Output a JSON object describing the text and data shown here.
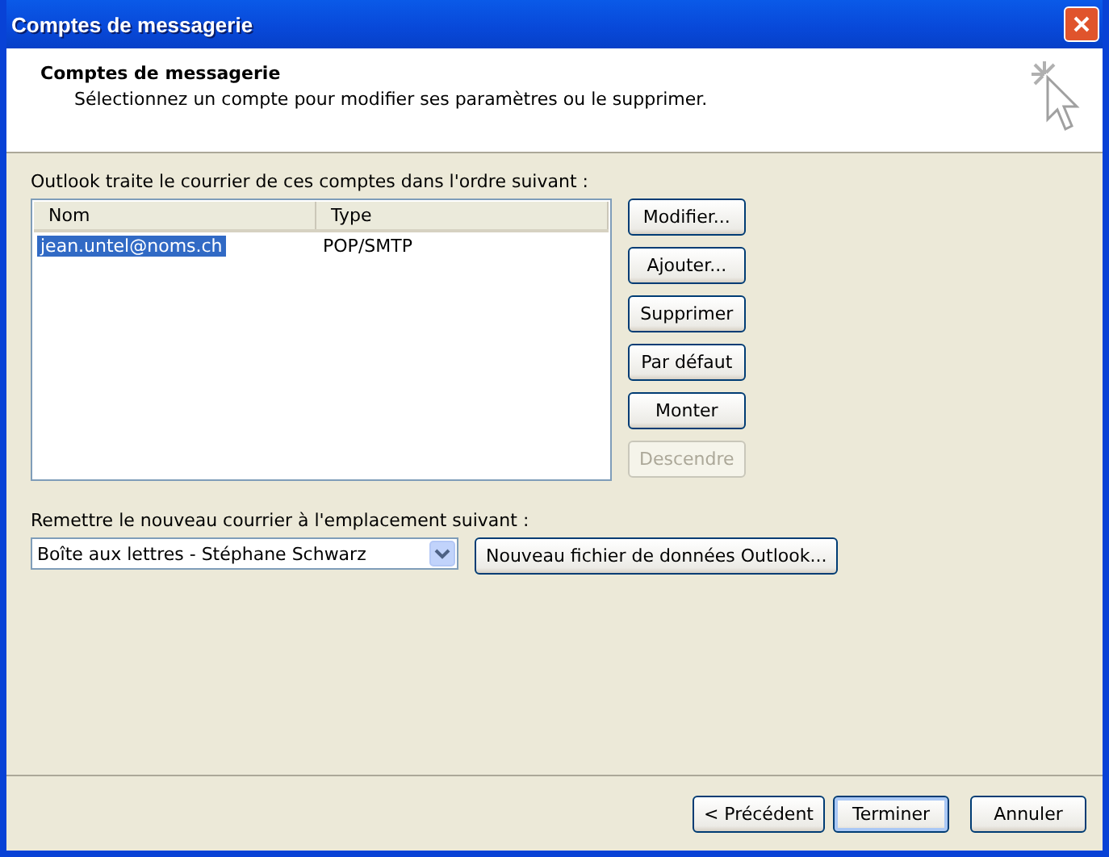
{
  "window": {
    "title": "Comptes de messagerie"
  },
  "header": {
    "title": "Comptes de messagerie",
    "subtitle": "Sélectionnez un compte pour modifier ses paramètres ou le supprimer."
  },
  "accounts": {
    "label": "Outlook traite le courrier de ces comptes dans l'ordre suivant :",
    "columns": [
      "Nom",
      "Type"
    ],
    "rows": [
      {
        "name": "jean.untel@noms.ch",
        "type": "POP/SMTP",
        "selected": true
      }
    ]
  },
  "actions": [
    {
      "label": "Modifier...",
      "disabled": false
    },
    {
      "label": "Ajouter...",
      "disabled": false
    },
    {
      "label": "Supprimer",
      "disabled": false
    },
    {
      "label": "Par défaut",
      "disabled": false
    },
    {
      "label": "Monter",
      "disabled": false
    },
    {
      "label": "Descendre",
      "disabled": true
    }
  ],
  "delivery": {
    "label": "Remettre le nouveau courrier à l'emplacement suivant :",
    "value": "Boîte aux lettres - Stéphane Schwarz",
    "new_file_button": "Nouveau fichier de données Outlook..."
  },
  "footer": [
    {
      "label": "< Précédent",
      "default": false
    },
    {
      "label": "Terminer",
      "default": true
    },
    {
      "label": "Annuler",
      "default": false
    }
  ]
}
